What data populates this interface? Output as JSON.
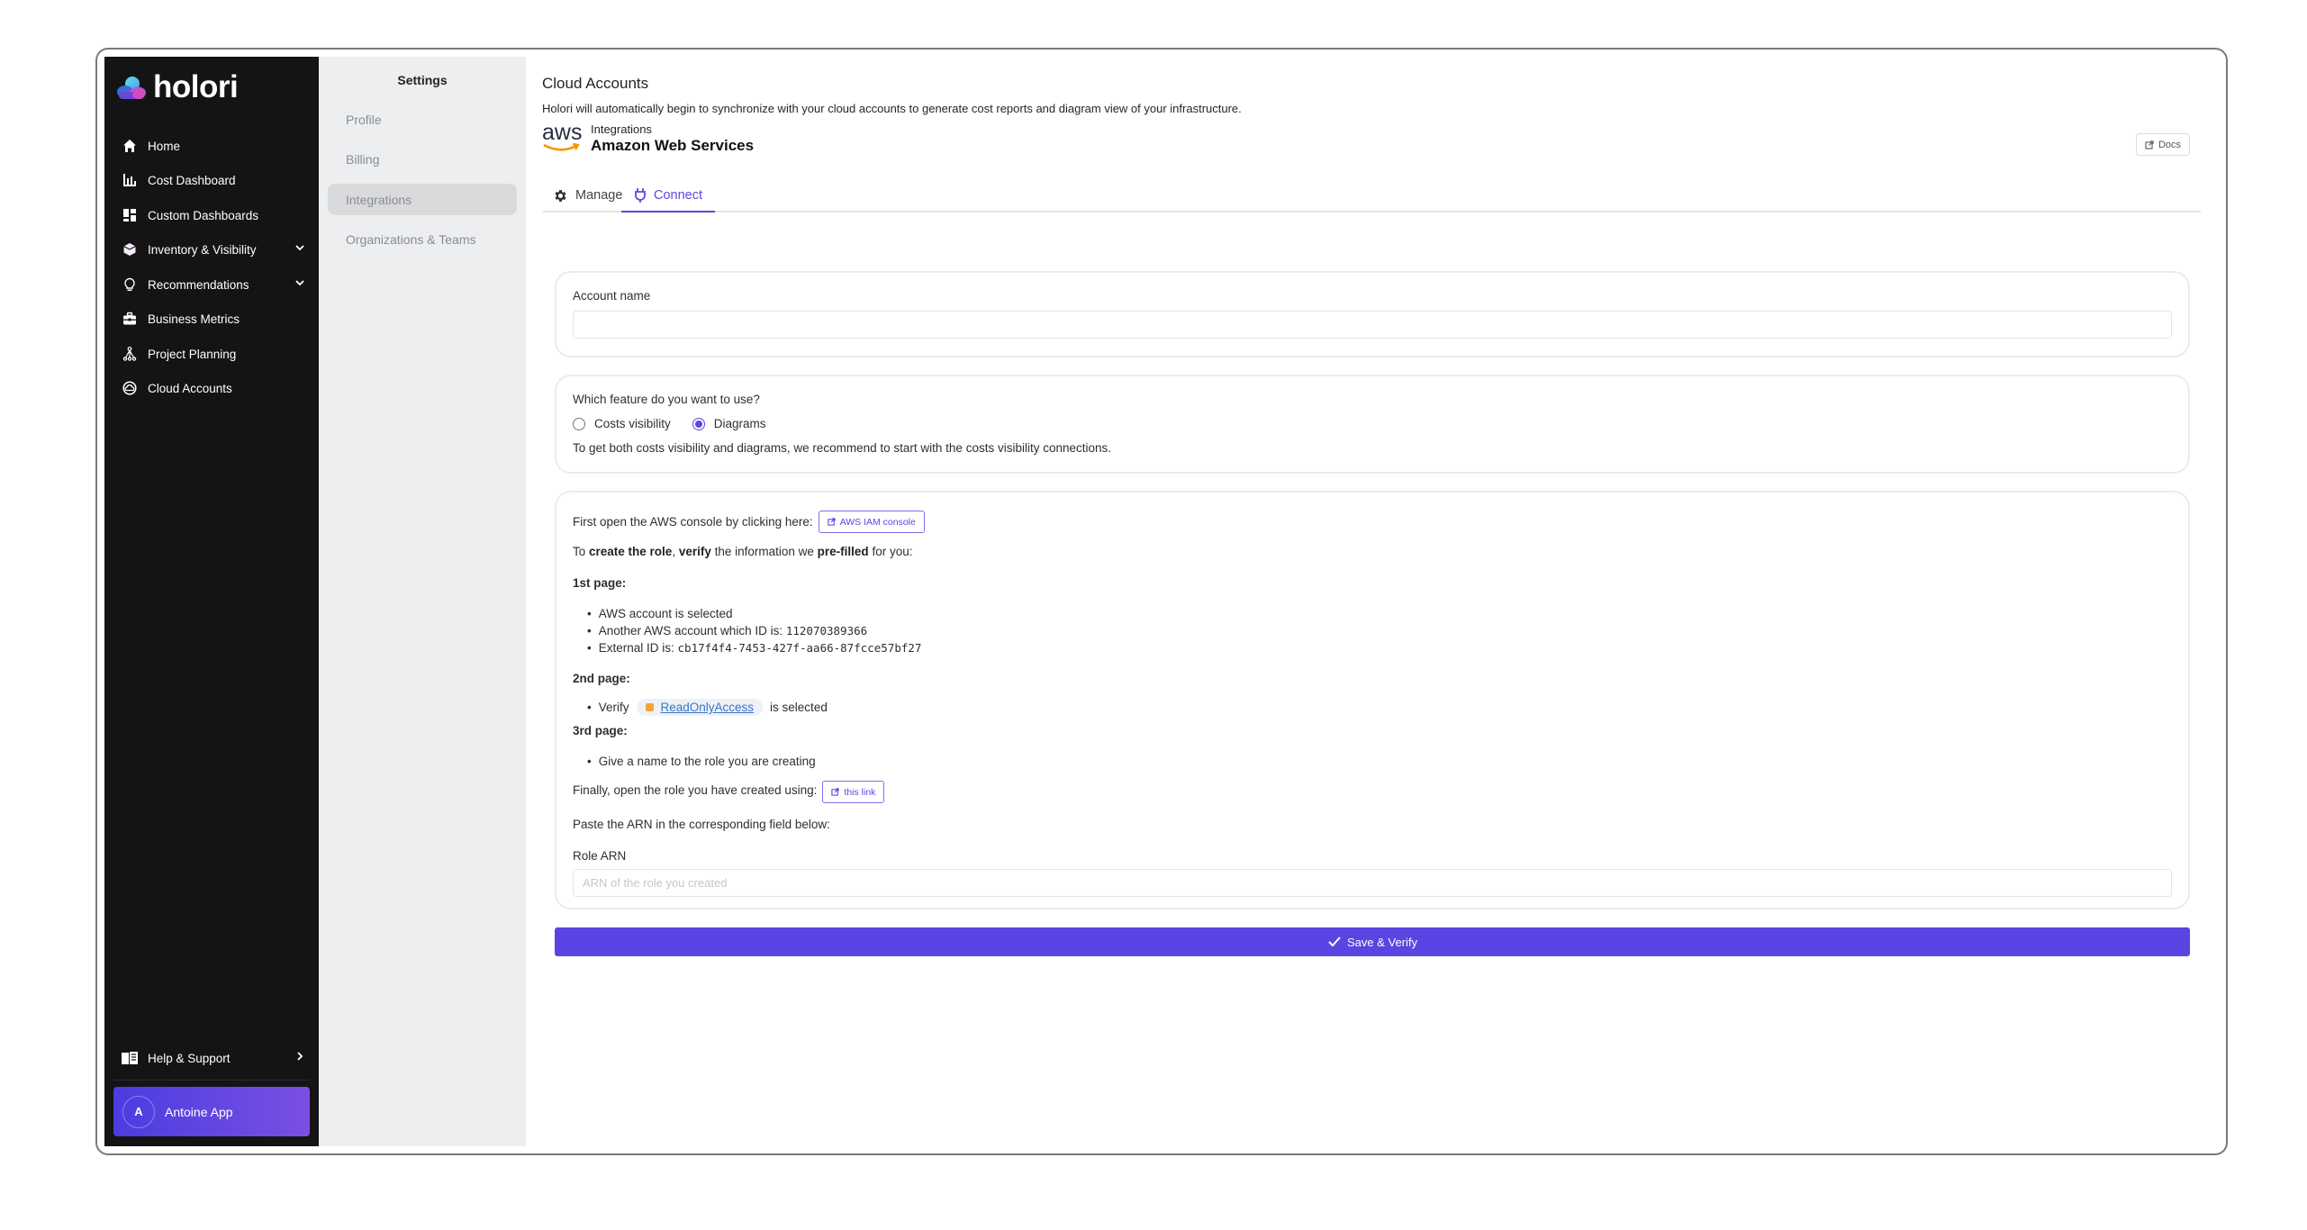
{
  "app": {
    "logo_text": "holori"
  },
  "sidebar": {
    "items": [
      {
        "label": "Home",
        "icon": "home-icon"
      },
      {
        "label": "Cost Dashboard",
        "icon": "bar-chart-icon"
      },
      {
        "label": "Custom Dashboards",
        "icon": "dashboard-grid-icon"
      },
      {
        "label": "Inventory & Visibility",
        "icon": "cube-icon",
        "expandable": true
      },
      {
        "label": "Recommendations",
        "icon": "lightbulb-icon",
        "expandable": true
      },
      {
        "label": "Business Metrics",
        "icon": "briefcase-icon"
      },
      {
        "label": "Project Planning",
        "icon": "hierarchy-icon"
      },
      {
        "label": "Cloud Accounts",
        "icon": "cloud-circle-icon"
      }
    ],
    "help": {
      "label": "Help & Support",
      "icon": "book-icon"
    },
    "user": {
      "initial": "A",
      "name": "Antoine App"
    }
  },
  "settings": {
    "title": "Settings",
    "items": [
      {
        "label": "Profile",
        "active": false
      },
      {
        "label": "Billing",
        "active": false
      },
      {
        "label": "Integrations",
        "active": true
      },
      {
        "label": "Organizations & Teams",
        "active": false
      }
    ]
  },
  "main": {
    "title": "Cloud Accounts",
    "description": "Holori will automatically begin to synchronize with your cloud accounts to generate cost reports and diagram view of your infrastructure.",
    "integration": {
      "logo_text": "aws",
      "subtitle": "Integrations",
      "name": "Amazon Web Services"
    },
    "docs_label": "Docs",
    "tabs": [
      {
        "label": "Manage",
        "icon": "gear-icon",
        "active": false
      },
      {
        "label": "Connect",
        "icon": "plug-icon",
        "active": true
      }
    ],
    "account_card": {
      "label": "Account name",
      "value": "",
      "placeholder": ""
    },
    "feature_card": {
      "question": "Which feature do you want to use?",
      "options": [
        {
          "label": "Costs visibility",
          "selected": false
        },
        {
          "label": "Diagrams",
          "selected": true
        }
      ],
      "hint": "To get both costs visibility and diagrams, we recommend to start with the costs visibility connections."
    },
    "instructions": {
      "open_console_text": "First open the AWS console by clicking here:",
      "console_button": "AWS IAM console",
      "create_prefix": "To ",
      "create_bold1": "create the role",
      "create_sep": ", ",
      "create_bold2": "verify",
      "create_mid": " the information we ",
      "create_bold3": "pre-filled",
      "create_suffix": " for you:",
      "page1_title": "1st page:",
      "page1_items": [
        "AWS account is selected",
        "Another AWS account which ID is:",
        "External ID is:"
      ],
      "account_id": "112070389366",
      "external_id": "cb17f4f4-7453-427f-aa66-87fcce57bf27",
      "page2_title": "2nd page:",
      "page2_verify": "Verify",
      "page2_policy": "ReadOnlyAccess",
      "page2_suffix": "is selected",
      "page3_title": "3rd page:",
      "page3_items": [
        "Give a name to the role you are creating"
      ],
      "finally_text": "Finally, open the role you have created using:",
      "finally_link": "this link",
      "paste_text": "Paste the ARN in the corresponding field below:",
      "role_arn_label": "Role ARN",
      "role_arn_placeholder": "ARN of the role you created",
      "role_arn_value": ""
    },
    "save_button": "Save & Verify"
  },
  "colors": {
    "accent": "#5a44e2",
    "sidebar_bg": "#141415",
    "settings_bg": "#eceef0",
    "chat_button": "#5b32cf",
    "policy_icon": "#f2a33a"
  }
}
